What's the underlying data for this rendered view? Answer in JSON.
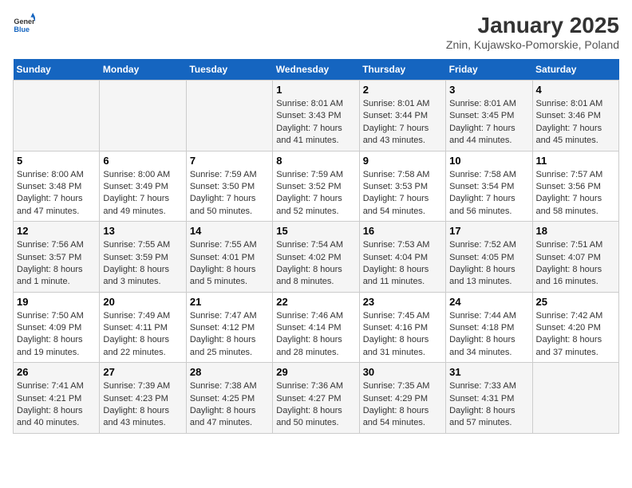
{
  "header": {
    "logo_general": "General",
    "logo_blue": "Blue",
    "title": "January 2025",
    "subtitle": "Znin, Kujawsko-Pomorskie, Poland"
  },
  "calendar": {
    "days_of_week": [
      "Sunday",
      "Monday",
      "Tuesday",
      "Wednesday",
      "Thursday",
      "Friday",
      "Saturday"
    ],
    "weeks": [
      [
        {
          "day": "",
          "info": ""
        },
        {
          "day": "",
          "info": ""
        },
        {
          "day": "",
          "info": ""
        },
        {
          "day": "1",
          "info": "Sunrise: 8:01 AM\nSunset: 3:43 PM\nDaylight: 7 hours\nand 41 minutes."
        },
        {
          "day": "2",
          "info": "Sunrise: 8:01 AM\nSunset: 3:44 PM\nDaylight: 7 hours\nand 43 minutes."
        },
        {
          "day": "3",
          "info": "Sunrise: 8:01 AM\nSunset: 3:45 PM\nDaylight: 7 hours\nand 44 minutes."
        },
        {
          "day": "4",
          "info": "Sunrise: 8:01 AM\nSunset: 3:46 PM\nDaylight: 7 hours\nand 45 minutes."
        }
      ],
      [
        {
          "day": "5",
          "info": "Sunrise: 8:00 AM\nSunset: 3:48 PM\nDaylight: 7 hours\nand 47 minutes."
        },
        {
          "day": "6",
          "info": "Sunrise: 8:00 AM\nSunset: 3:49 PM\nDaylight: 7 hours\nand 49 minutes."
        },
        {
          "day": "7",
          "info": "Sunrise: 7:59 AM\nSunset: 3:50 PM\nDaylight: 7 hours\nand 50 minutes."
        },
        {
          "day": "8",
          "info": "Sunrise: 7:59 AM\nSunset: 3:52 PM\nDaylight: 7 hours\nand 52 minutes."
        },
        {
          "day": "9",
          "info": "Sunrise: 7:58 AM\nSunset: 3:53 PM\nDaylight: 7 hours\nand 54 minutes."
        },
        {
          "day": "10",
          "info": "Sunrise: 7:58 AM\nSunset: 3:54 PM\nDaylight: 7 hours\nand 56 minutes."
        },
        {
          "day": "11",
          "info": "Sunrise: 7:57 AM\nSunset: 3:56 PM\nDaylight: 7 hours\nand 58 minutes."
        }
      ],
      [
        {
          "day": "12",
          "info": "Sunrise: 7:56 AM\nSunset: 3:57 PM\nDaylight: 8 hours\nand 1 minute."
        },
        {
          "day": "13",
          "info": "Sunrise: 7:55 AM\nSunset: 3:59 PM\nDaylight: 8 hours\nand 3 minutes."
        },
        {
          "day": "14",
          "info": "Sunrise: 7:55 AM\nSunset: 4:01 PM\nDaylight: 8 hours\nand 5 minutes."
        },
        {
          "day": "15",
          "info": "Sunrise: 7:54 AM\nSunset: 4:02 PM\nDaylight: 8 hours\nand 8 minutes."
        },
        {
          "day": "16",
          "info": "Sunrise: 7:53 AM\nSunset: 4:04 PM\nDaylight: 8 hours\nand 11 minutes."
        },
        {
          "day": "17",
          "info": "Sunrise: 7:52 AM\nSunset: 4:05 PM\nDaylight: 8 hours\nand 13 minutes."
        },
        {
          "day": "18",
          "info": "Sunrise: 7:51 AM\nSunset: 4:07 PM\nDaylight: 8 hours\nand 16 minutes."
        }
      ],
      [
        {
          "day": "19",
          "info": "Sunrise: 7:50 AM\nSunset: 4:09 PM\nDaylight: 8 hours\nand 19 minutes."
        },
        {
          "day": "20",
          "info": "Sunrise: 7:49 AM\nSunset: 4:11 PM\nDaylight: 8 hours\nand 22 minutes."
        },
        {
          "day": "21",
          "info": "Sunrise: 7:47 AM\nSunset: 4:12 PM\nDaylight: 8 hours\nand 25 minutes."
        },
        {
          "day": "22",
          "info": "Sunrise: 7:46 AM\nSunset: 4:14 PM\nDaylight: 8 hours\nand 28 minutes."
        },
        {
          "day": "23",
          "info": "Sunrise: 7:45 AM\nSunset: 4:16 PM\nDaylight: 8 hours\nand 31 minutes."
        },
        {
          "day": "24",
          "info": "Sunrise: 7:44 AM\nSunset: 4:18 PM\nDaylight: 8 hours\nand 34 minutes."
        },
        {
          "day": "25",
          "info": "Sunrise: 7:42 AM\nSunset: 4:20 PM\nDaylight: 8 hours\nand 37 minutes."
        }
      ],
      [
        {
          "day": "26",
          "info": "Sunrise: 7:41 AM\nSunset: 4:21 PM\nDaylight: 8 hours\nand 40 minutes."
        },
        {
          "day": "27",
          "info": "Sunrise: 7:39 AM\nSunset: 4:23 PM\nDaylight: 8 hours\nand 43 minutes."
        },
        {
          "day": "28",
          "info": "Sunrise: 7:38 AM\nSunset: 4:25 PM\nDaylight: 8 hours\nand 47 minutes."
        },
        {
          "day": "29",
          "info": "Sunrise: 7:36 AM\nSunset: 4:27 PM\nDaylight: 8 hours\nand 50 minutes."
        },
        {
          "day": "30",
          "info": "Sunrise: 7:35 AM\nSunset: 4:29 PM\nDaylight: 8 hours\nand 54 minutes."
        },
        {
          "day": "31",
          "info": "Sunrise: 7:33 AM\nSunset: 4:31 PM\nDaylight: 8 hours\nand 57 minutes."
        },
        {
          "day": "",
          "info": ""
        }
      ]
    ]
  }
}
